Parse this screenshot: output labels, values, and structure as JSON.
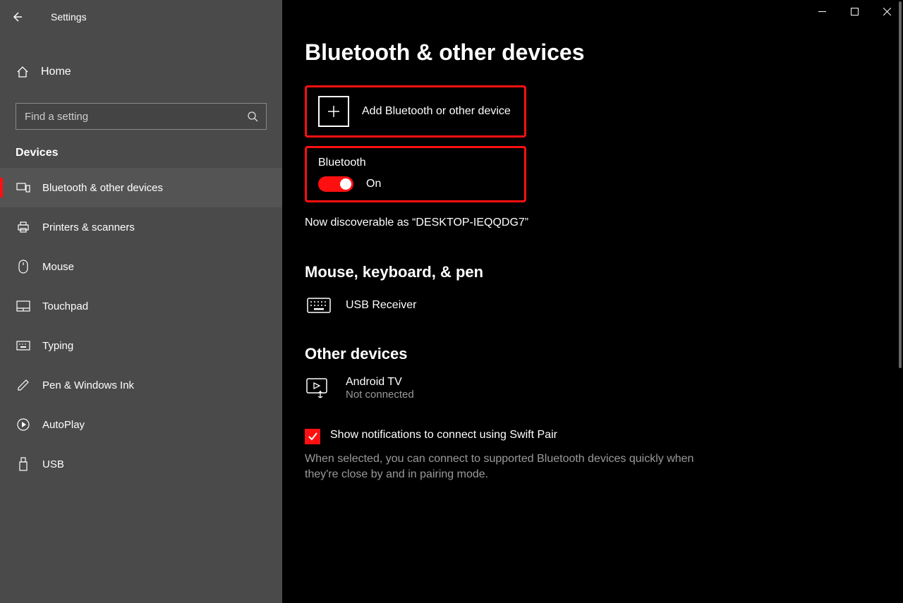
{
  "window": {
    "title": "Settings"
  },
  "sidebar": {
    "home": "Home",
    "searchPlaceholder": "Find a setting",
    "category": "Devices",
    "items": [
      {
        "label": "Bluetooth & other devices",
        "active": true
      },
      {
        "label": "Printers & scanners"
      },
      {
        "label": "Mouse"
      },
      {
        "label": "Touchpad"
      },
      {
        "label": "Typing"
      },
      {
        "label": "Pen & Windows Ink"
      },
      {
        "label": "AutoPlay"
      },
      {
        "label": "USB"
      }
    ]
  },
  "main": {
    "pageTitle": "Bluetooth & other devices",
    "addDevice": "Add Bluetooth or other device",
    "bluetoothLabel": "Bluetooth",
    "bluetoothState": "On",
    "discoverable": "Now discoverable as “DESKTOP-IEQQDG7”",
    "section1": "Mouse, keyboard, & pen",
    "device1": {
      "name": "USB Receiver"
    },
    "section2": "Other devices",
    "device2": {
      "name": "Android TV",
      "status": "Not connected"
    },
    "swiftPairLabel": "Show notifications to connect using Swift Pair",
    "swiftPairDesc": "When selected, you can connect to supported Bluetooth devices quickly when they're close by and in pairing mode."
  }
}
